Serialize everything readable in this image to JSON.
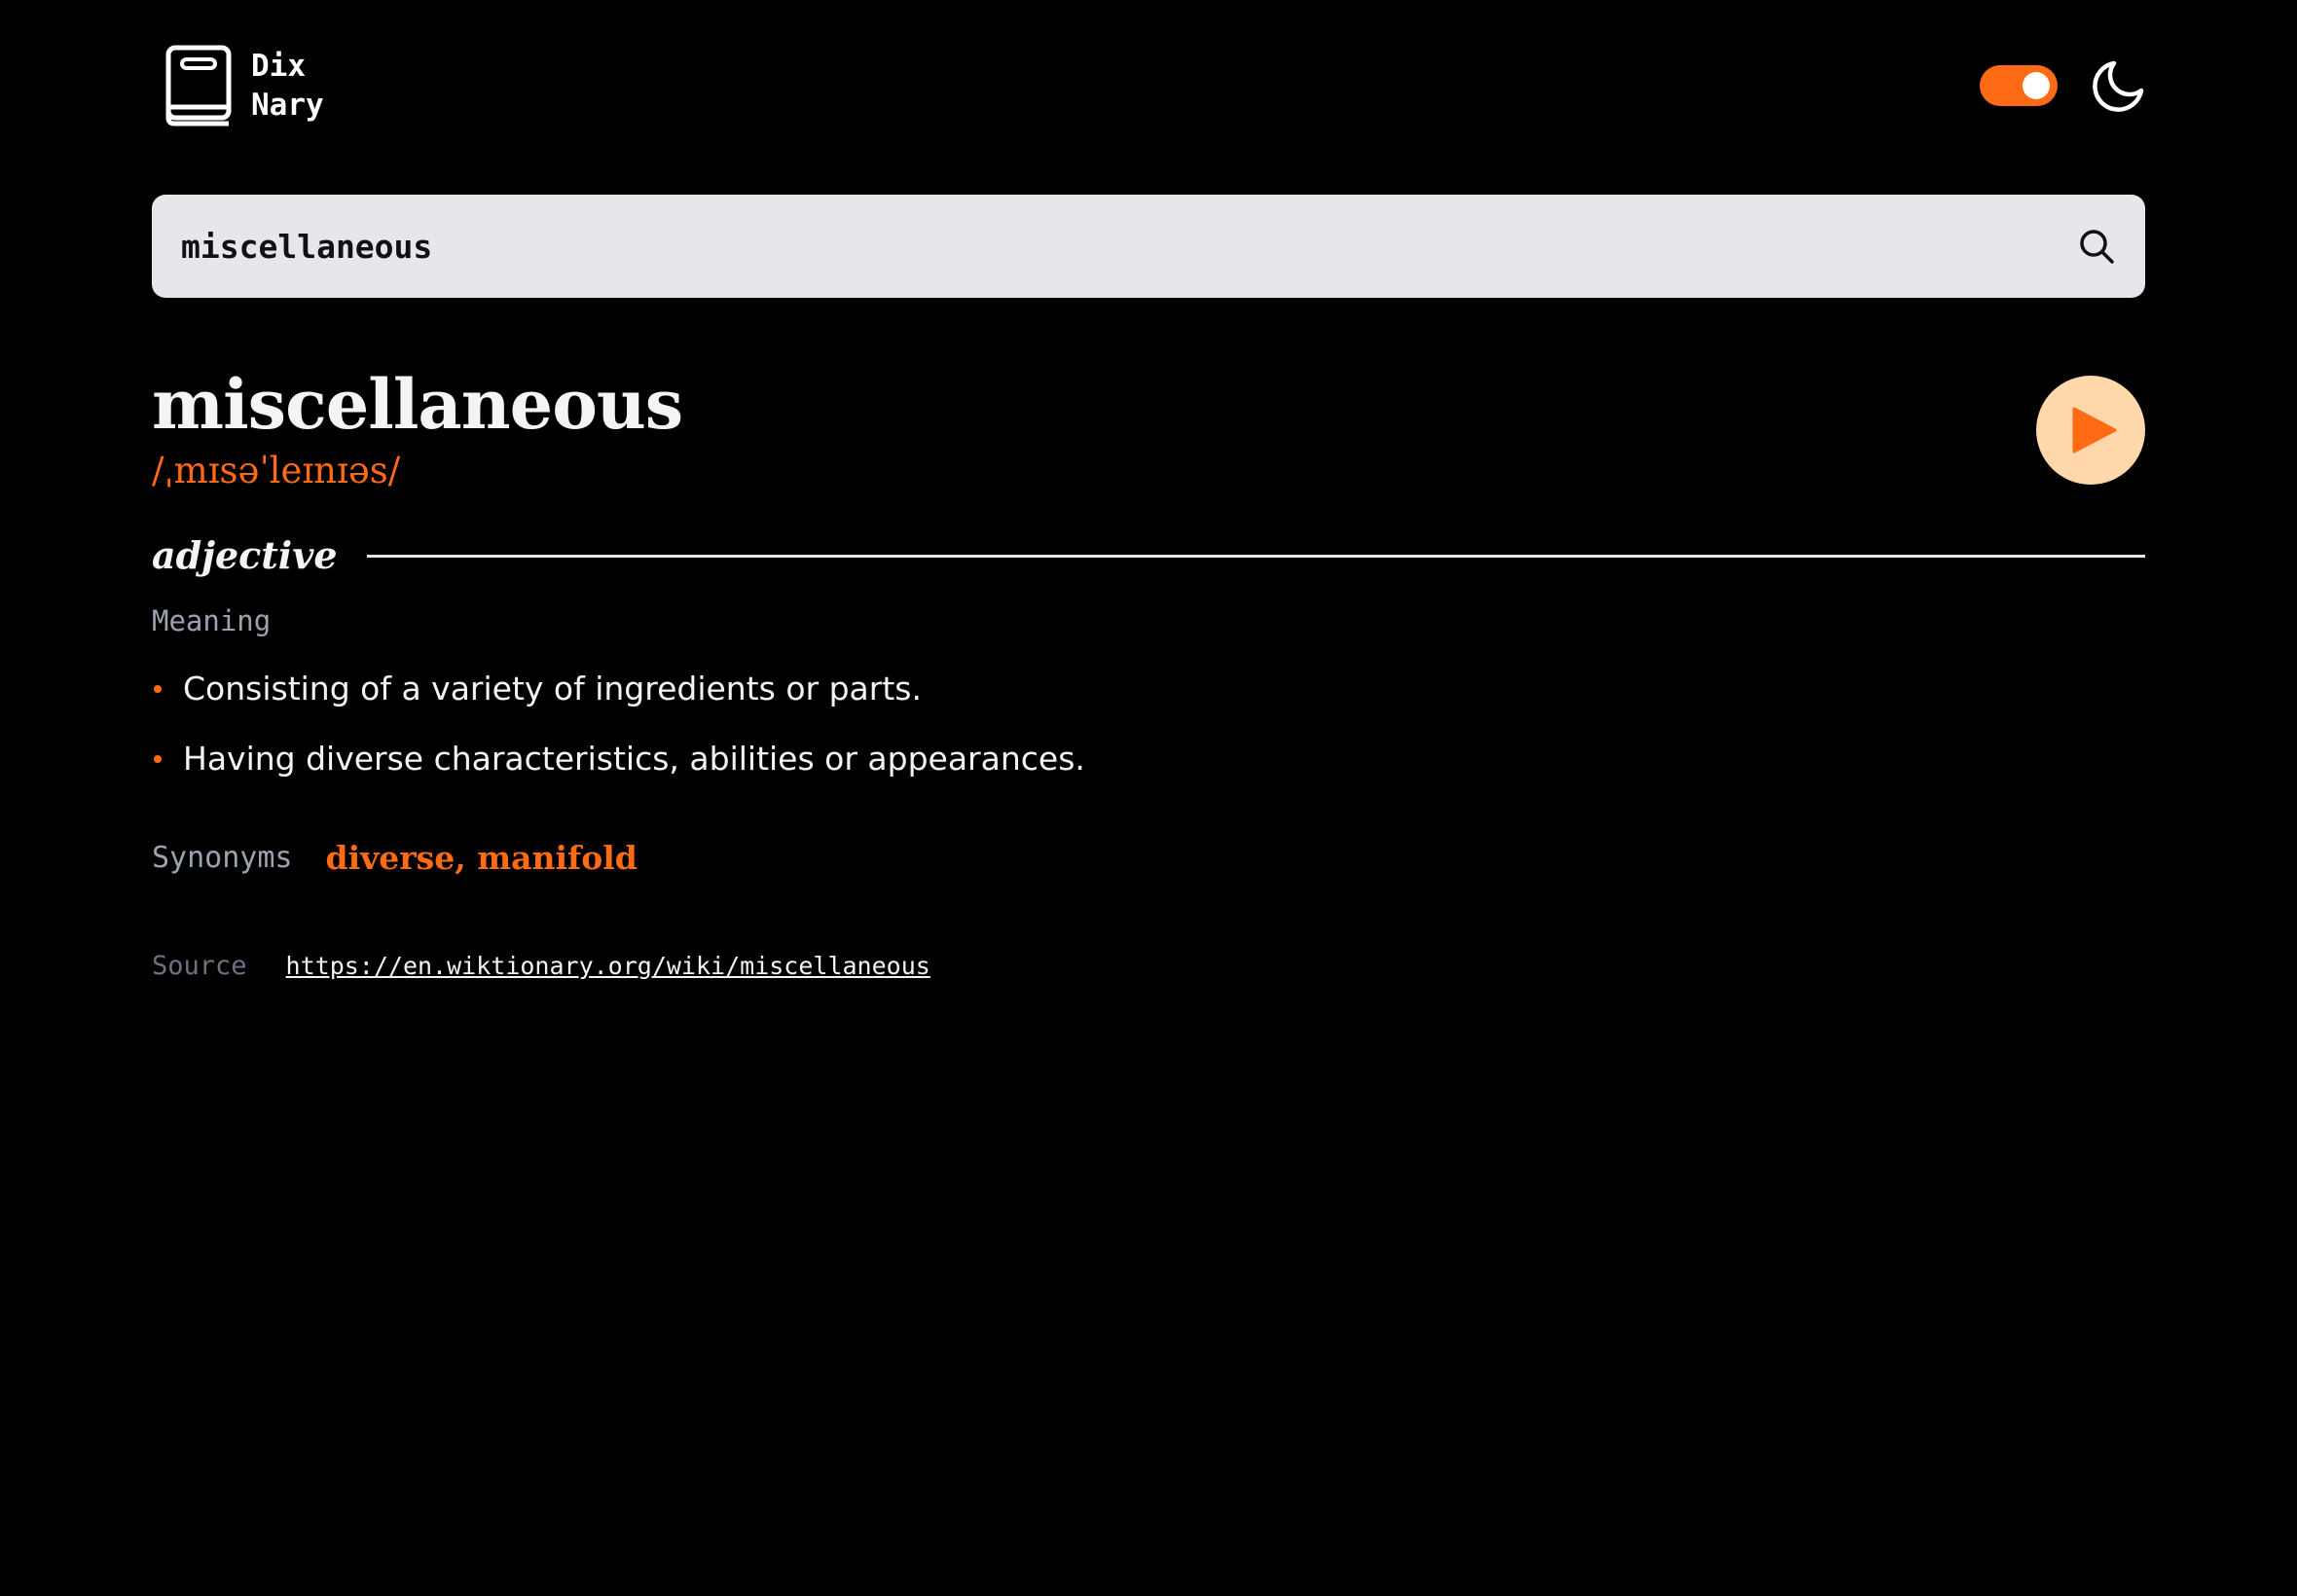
{
  "brand": {
    "line1": "Dix",
    "line2": "Nary",
    "icon": "book-icon"
  },
  "header": {
    "theme_toggle_on": true,
    "theme_icon": "moon-icon"
  },
  "search": {
    "value": "miscellaneous",
    "icon": "search-icon"
  },
  "entry": {
    "word": "miscellaneous",
    "phonetic": "/ˌmɪsəˈleɪnɪəs/",
    "play_icon": "play-icon",
    "part_of_speech": "adjective",
    "meaning_label": "Meaning",
    "definitions": [
      "Consisting of a variety of ingredients or parts.",
      "Having diverse characteristics, abilities or appearances."
    ],
    "synonyms_label": "Synonyms",
    "synonyms": "diverse, manifold",
    "source_label": "Source",
    "source_url": "https://en.wiktionary.org/wiki/miscellaneous"
  },
  "colors": {
    "accent": "#ff6b14",
    "background": "#000000",
    "search_bg": "#e5e7eb",
    "play_bg": "#fed7aa"
  }
}
